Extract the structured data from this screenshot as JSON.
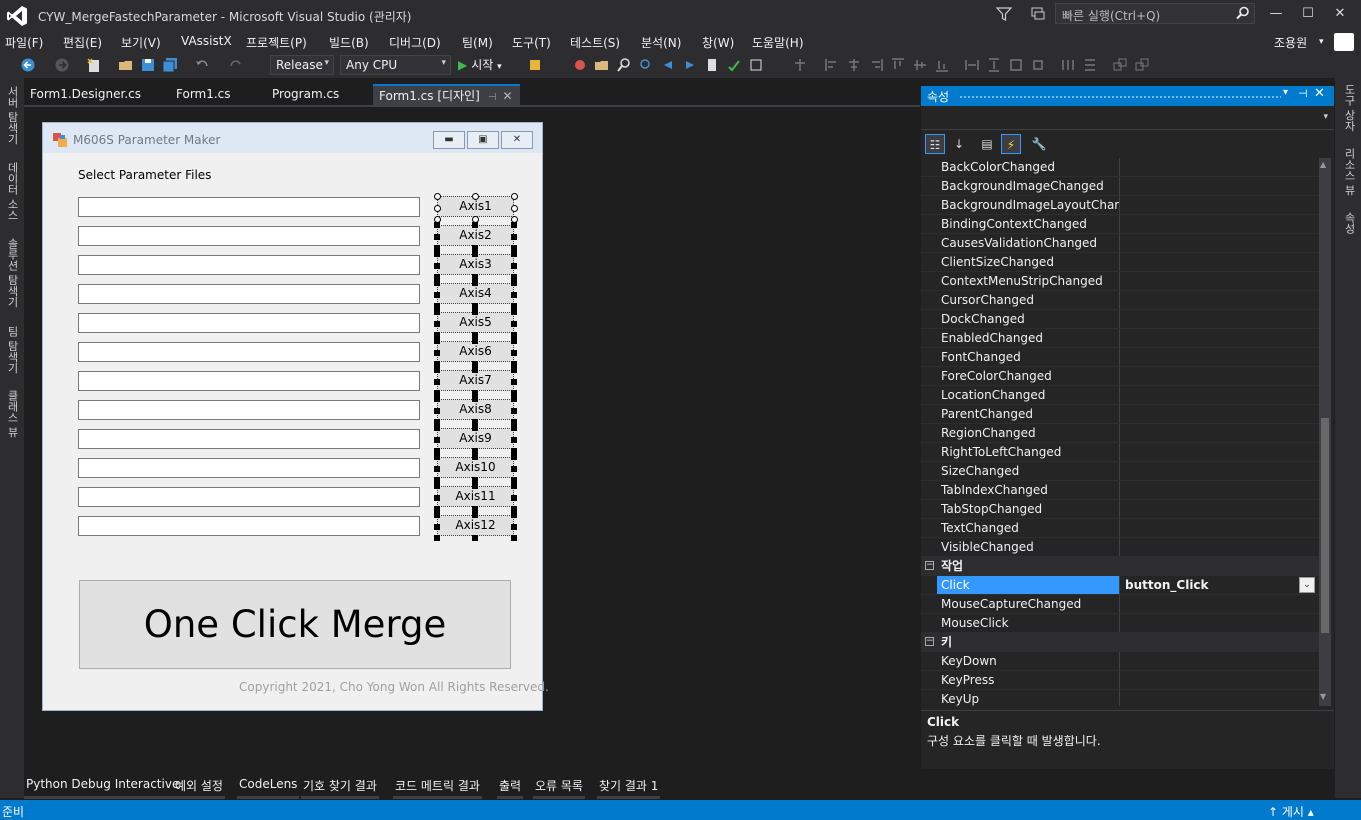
{
  "window": {
    "title": "CYW_MergeFastechParameter - Microsoft Visual Studio (관리자)",
    "quick_launch_placeholder": "빠른 실행(Ctrl+Q)",
    "minimize": "—",
    "maximize": "☐",
    "close": "✕"
  },
  "menu": {
    "items": [
      "파일(F)",
      "편집(E)",
      "보기(V)",
      "VAssistX",
      "프로젝트(P)",
      "빌드(B)",
      "디버그(D)",
      "팀(M)",
      "도구(T)",
      "테스트(S)",
      "분석(N)",
      "창(W)",
      "도움말(H)"
    ],
    "user": "조용원"
  },
  "toolbar": {
    "configuration": "Release",
    "platform": "Any CPU",
    "start_label": "시작",
    "start_icon": "▶"
  },
  "left_tabs": [
    "서버 탐색기",
    "데이터 소스",
    "솔루션 탐색기",
    "팀 탐색기",
    "클래스 뷰"
  ],
  "right_tabs": [
    "도구 상자",
    "리소스 뷰",
    "속성"
  ],
  "doc_tabs": [
    "Form1.Designer.cs",
    "Form1.cs",
    "Program.cs",
    "Form1.cs [디자인]"
  ],
  "form": {
    "title": "M606S Parameter Maker",
    "select_label": "Select Parameter Files",
    "axis_buttons": [
      "Axis1",
      "Axis2",
      "Axis3",
      "Axis4",
      "Axis5",
      "Axis6",
      "Axis7",
      "Axis8",
      "Axis9",
      "Axis10",
      "Axis11",
      "Axis12"
    ],
    "merge_button": "One Click Merge",
    "copyright": "Copyright 2021, Cho Yong Won All Rights Reserved."
  },
  "properties": {
    "title": "속성",
    "events": [
      {
        "name": "BackColorChanged",
        "value": ""
      },
      {
        "name": "BackgroundImageChanged",
        "value": ""
      },
      {
        "name": "BackgroundImageLayoutChanged",
        "value": ""
      },
      {
        "name": "BindingContextChanged",
        "value": ""
      },
      {
        "name": "CausesValidationChanged",
        "value": ""
      },
      {
        "name": "ClientSizeChanged",
        "value": ""
      },
      {
        "name": "ContextMenuStripChanged",
        "value": ""
      },
      {
        "name": "CursorChanged",
        "value": ""
      },
      {
        "name": "DockChanged",
        "value": ""
      },
      {
        "name": "EnabledChanged",
        "value": ""
      },
      {
        "name": "FontChanged",
        "value": ""
      },
      {
        "name": "ForeColorChanged",
        "value": ""
      },
      {
        "name": "LocationChanged",
        "value": ""
      },
      {
        "name": "ParentChanged",
        "value": ""
      },
      {
        "name": "RegionChanged",
        "value": ""
      },
      {
        "name": "RightToLeftChanged",
        "value": ""
      },
      {
        "name": "SizeChanged",
        "value": ""
      },
      {
        "name": "TabIndexChanged",
        "value": ""
      },
      {
        "name": "TabStopChanged",
        "value": ""
      },
      {
        "name": "TextChanged",
        "value": ""
      },
      {
        "name": "VisibleChanged",
        "value": ""
      }
    ],
    "categories": [
      {
        "name": "작업",
        "events": [
          {
            "name": "Click",
            "value": "button_Click",
            "selected": true
          },
          {
            "name": "MouseCaptureChanged",
            "value": ""
          },
          {
            "name": "MouseClick",
            "value": ""
          }
        ]
      },
      {
        "name": "키",
        "events": [
          {
            "name": "KeyDown",
            "value": ""
          },
          {
            "name": "KeyPress",
            "value": ""
          },
          {
            "name": "KeyUp",
            "value": ""
          }
        ]
      }
    ],
    "description_title": "Click",
    "description_text": "구성 요소를 클릭할 때 발생합니다."
  },
  "bottom_tabs": [
    "Python Debug Interactive",
    "예외 설정",
    "CodeLens",
    "기호 찾기 결과",
    "코드 메트릭 결과",
    "출력",
    "오류 목록",
    "찾기 결과 1"
  ],
  "status": {
    "text": "준비",
    "publish": "↑ 게시 ▴"
  },
  "colors": {
    "accent": "#007acc",
    "chrome": "#2d2d30",
    "editor_bg": "#1e1e1e",
    "selection": "#3399ff"
  }
}
